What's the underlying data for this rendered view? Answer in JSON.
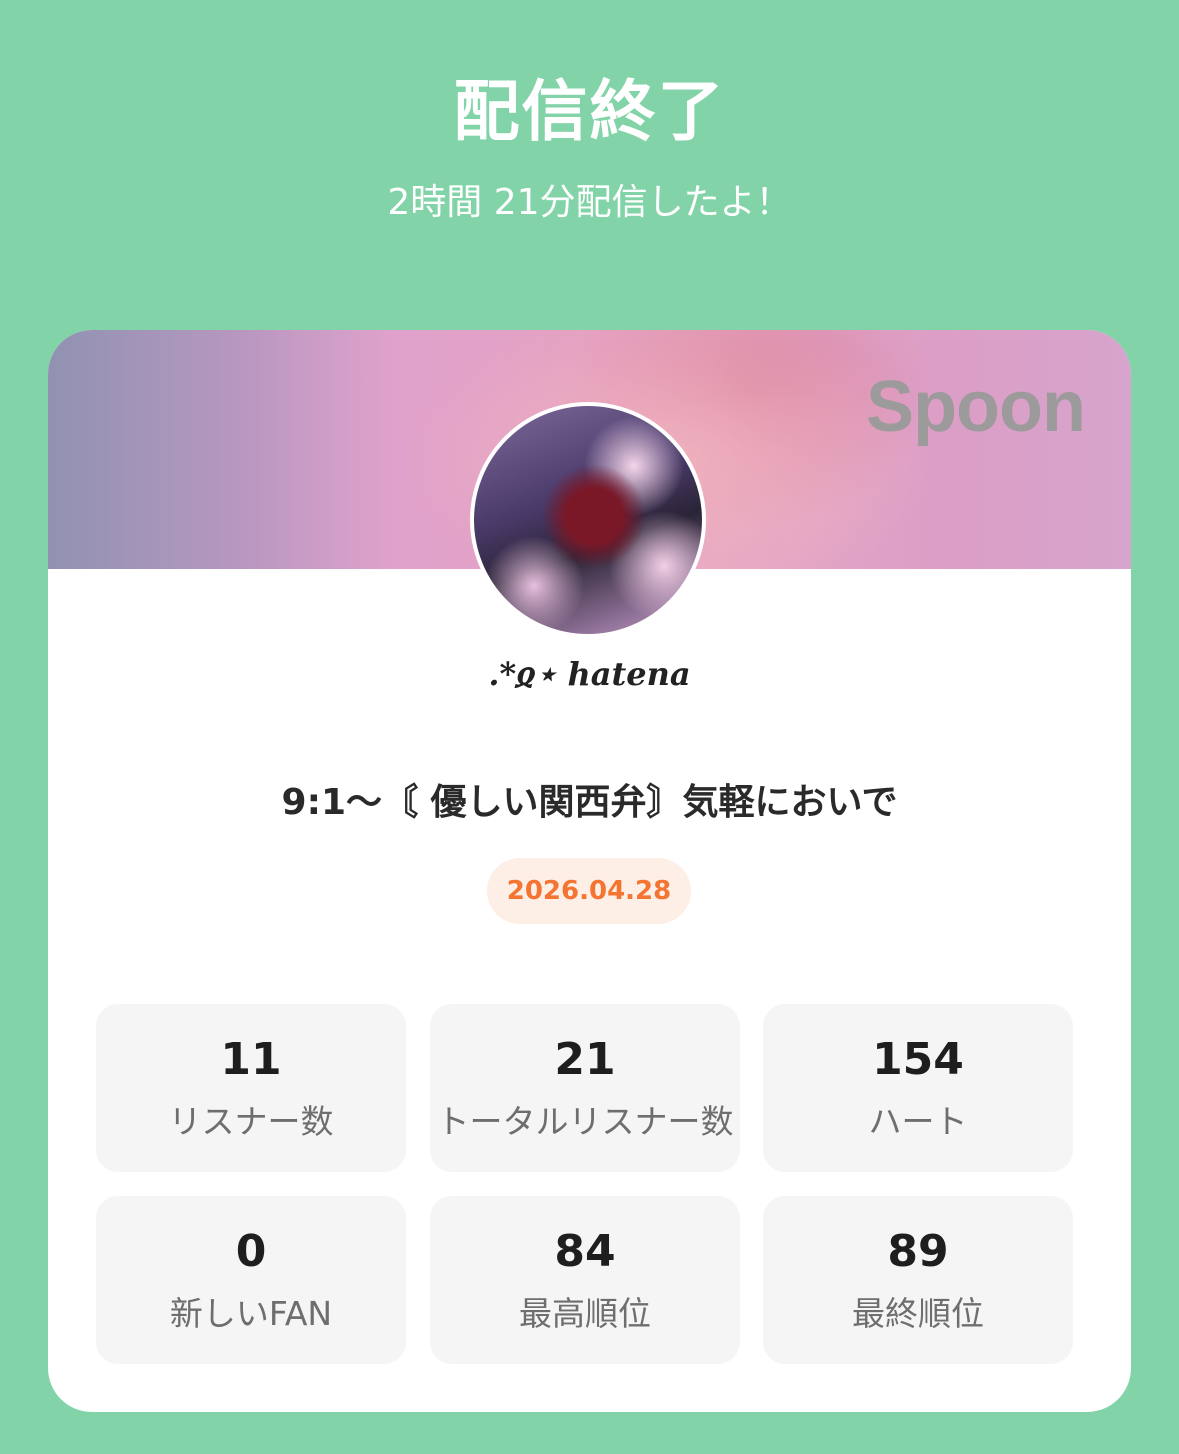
{
  "header": {
    "title": "配信終了",
    "subtitle": "2時間 21分配信したよ！"
  },
  "card": {
    "logo": "Spoon",
    "username": ".*ჲ⋆ hatena",
    "stream_title": "9:1〜〘 優しい関西弁〙気軽においで",
    "date": "2026.04.28"
  },
  "stats": [
    {
      "value": "11",
      "label": "リスナー数"
    },
    {
      "value": "21",
      "label": "トータルリスナー数"
    },
    {
      "value": "154",
      "label": "ハート"
    },
    {
      "value": "0",
      "label": "新しいFAN"
    },
    {
      "value": "84",
      "label": "最高順位"
    },
    {
      "value": "89",
      "label": "最終順位"
    }
  ]
}
